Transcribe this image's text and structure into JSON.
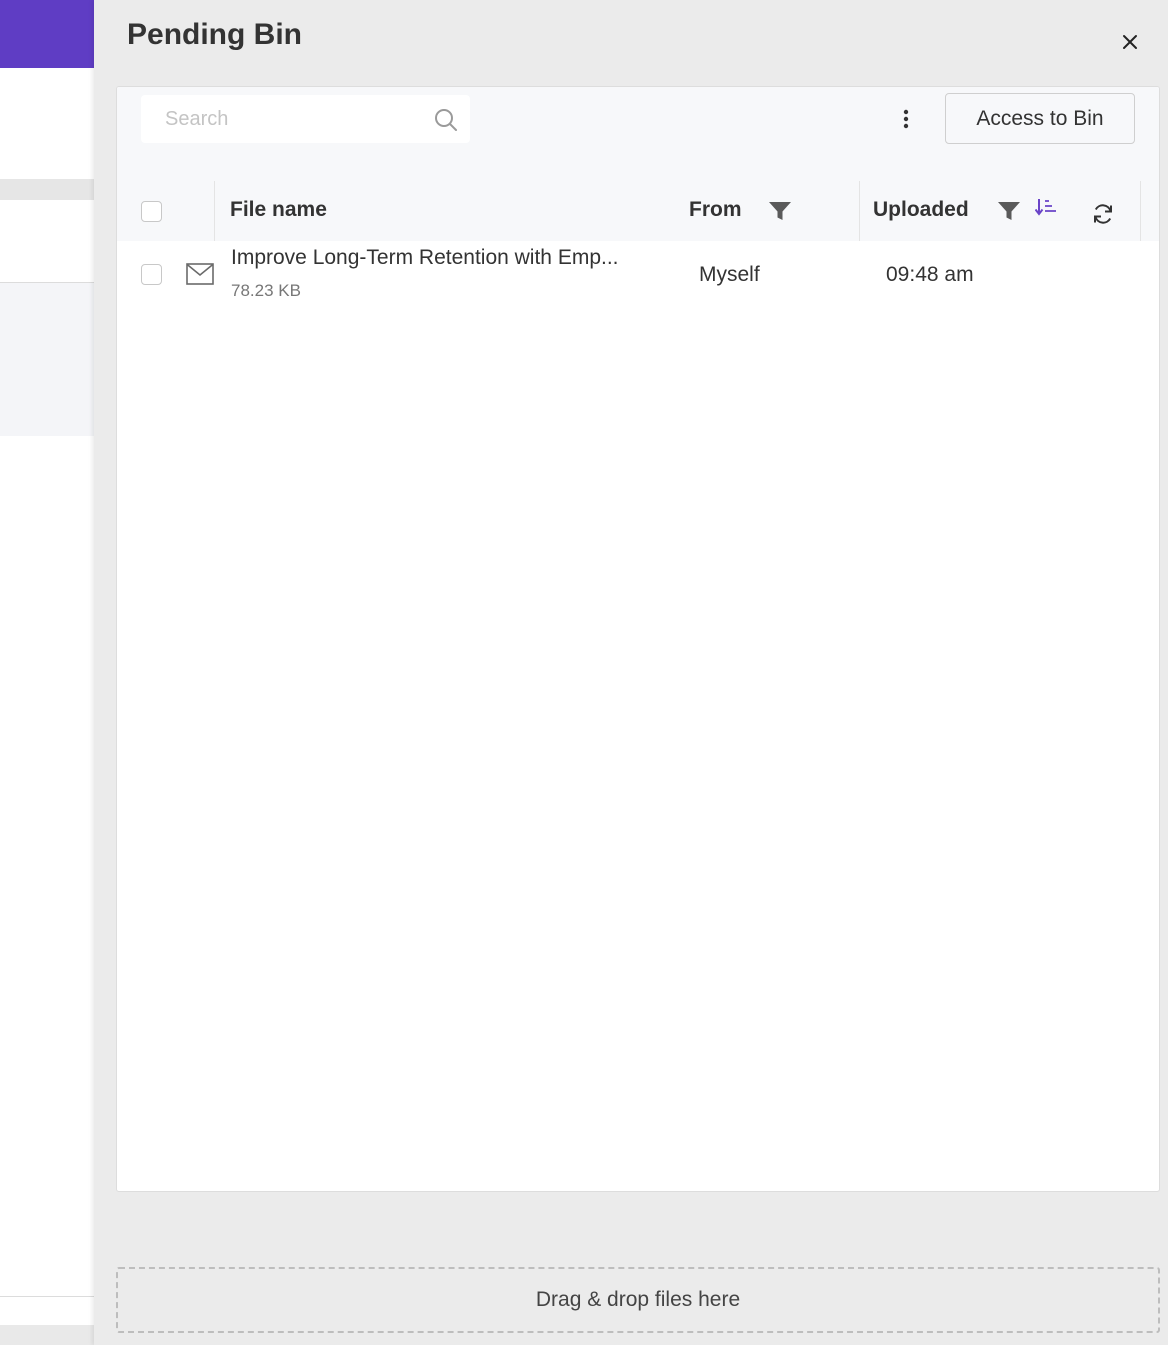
{
  "panel": {
    "title": "Pending Bin",
    "close_icon": "close-icon"
  },
  "toolbar": {
    "search_placeholder": "Search",
    "search_icon": "search-icon",
    "more_icon": "kebab-menu-icon",
    "access_button_label": "Access to Bin"
  },
  "table": {
    "columns": {
      "file_name": "File name",
      "from": "From",
      "uploaded": "Uploaded"
    },
    "icons": [
      "filter-icon",
      "sort-descending-icon",
      "refresh-icon"
    ],
    "rows": [
      {
        "icon": "email-icon",
        "file_name": "Improve Long-Term Retention with Emp...",
        "size": "78.23 KB",
        "from": "Myself",
        "uploaded": "09:48 am"
      }
    ]
  },
  "dropzone": {
    "label": "Drag & drop files here"
  },
  "colors": {
    "accent": "#5f3dc4",
    "panel_bg": "#ebebeb",
    "toolbar_bg": "#f7f8fa"
  }
}
